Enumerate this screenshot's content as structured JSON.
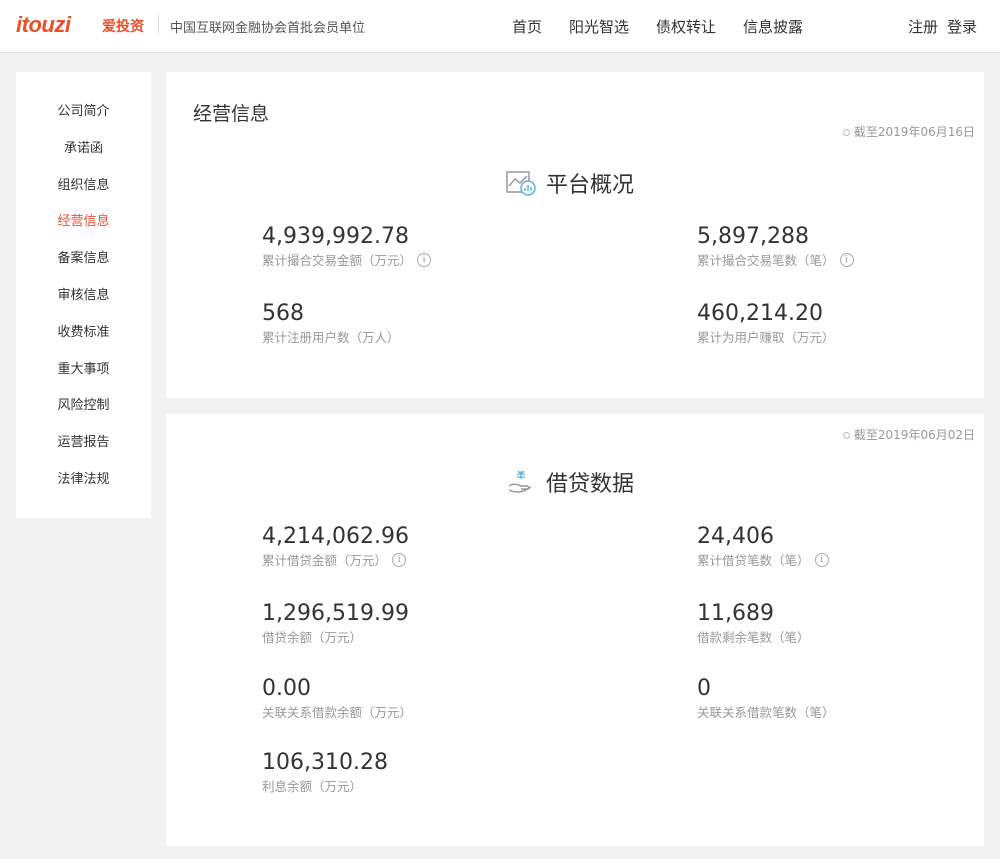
{
  "header": {
    "logo": "itouzi",
    "logo_cn": "爱投资",
    "slogan": "中国互联网金融协会首批会员单位",
    "nav": [
      "首页",
      "阳光智选",
      "债权转让",
      "信息披露"
    ],
    "register": "注册",
    "login": "登录"
  },
  "sidebar": {
    "items": [
      "公司简介",
      "承诺函",
      "组织信息",
      "经营信息",
      "备案信息",
      "审核信息",
      "收费标准",
      "重大事项",
      "风险控制",
      "运营报告",
      "法律法规"
    ],
    "active": 3
  },
  "page_title": "经营信息",
  "platform": {
    "date": "截至2019年06月16日",
    "title": "平台概况",
    "stats": [
      {
        "value": "4,939,992.78",
        "label": "累计撮合交易金额（万元）",
        "info": true
      },
      {
        "value": "5,897,288",
        "label": "累计撮合交易笔数（笔）",
        "info": true
      },
      {
        "value": "568",
        "label": "累计注册用户数（万人）"
      },
      {
        "value": "460,214.20",
        "label": "累计为用户赚取（万元）"
      }
    ]
  },
  "loan": {
    "date": "截至2019年06月02日",
    "title": "借贷数据",
    "stats": [
      {
        "value": "4,214,062.96",
        "label": "累计借贷金额（万元）",
        "info": true
      },
      {
        "value": "24,406",
        "label": "累计借贷笔数（笔）",
        "info": true
      },
      {
        "value": "1,296,519.99",
        "label": "借贷余额（万元）"
      },
      {
        "value": "11,689",
        "label": "借款剩余笔数（笔）"
      },
      {
        "value": "0.00",
        "label": "关联关系借款余额（万元）"
      },
      {
        "value": "0",
        "label": "关联关系借款笔数（笔）"
      },
      {
        "value": "106,310.28",
        "label": "利息余额（万元）"
      }
    ]
  },
  "info_glyph": "i",
  "colors": {
    "brand": "#e8502a",
    "active": "#e8503c"
  }
}
